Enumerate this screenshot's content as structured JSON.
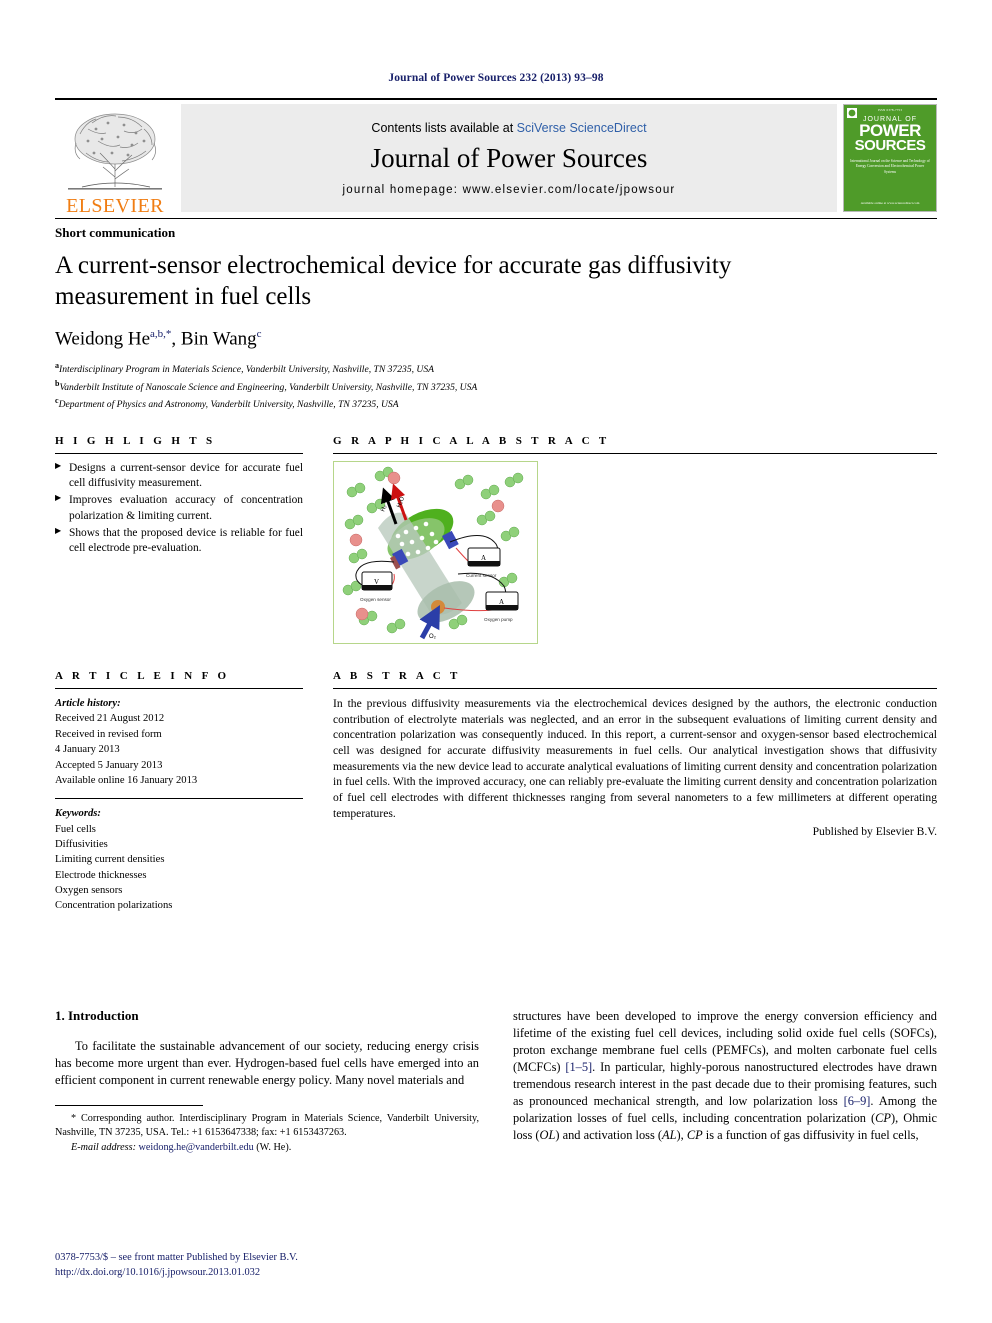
{
  "running_head": "Journal of Power Sources 232 (2013) 93–98",
  "masthead": {
    "publisher_wordmark": "ELSEVIER",
    "contents_prefix": "Contents lists available at ",
    "contents_link": "SciVerse ScienceDirect",
    "journal_title": "Journal of Power Sources",
    "homepage": "journal homepage: www.elsevier.com/locate/jpowsour",
    "cover": {
      "top_label": "ISSN 0378-7753",
      "line1": "JOURNAL OF",
      "line2": "POWER",
      "line3": "SOURCES",
      "subtitle": "International Journal on the Science and Technology of Energy Conversion and Electrochemical Power Systems",
      "footer": "Available online at\nwww.sciencedirect.com"
    }
  },
  "article": {
    "class": "Short communication",
    "title": "A current-sensor electrochemical device for accurate gas diffusivity measurement in fuel cells",
    "authors_html": "Weidong He<sup>a,b,*</sup>, Bin Wang<sup>c</sup>",
    "affiliations": [
      {
        "marker": "a",
        "text": "Interdisciplinary Program in Materials Science, Vanderbilt University, Nashville, TN 37235, USA"
      },
      {
        "marker": "b",
        "text": "Vanderbilt Institute of Nanoscale Science and Engineering, Vanderbilt University, Nashville, TN 37235, USA"
      },
      {
        "marker": "c",
        "text": "Department of Physics and Astronomy, Vanderbilt University, Nashville, TN 37235, USA"
      }
    ]
  },
  "highlights": {
    "heading": "H I G H L I G H T S",
    "items": [
      "Designs a current-sensor device for accurate fuel cell diffusivity measurement.",
      "Improves evaluation accuracy of concentration polarization & limiting current.",
      "Shows that the proposed device is reliable for fuel cell electrode pre-evaluation."
    ]
  },
  "graphical_abstract": {
    "heading": "G R A P H I C A L   A B S T R A C T",
    "labels": {
      "oxygen_sensor": "Oxygen sensor",
      "current_sensor": "Current sensor",
      "oxygen_pump": "Oxygen pump",
      "inlet_gas": "O₂",
      "arrow_in": "H₂",
      "arrow_out": "H₂O",
      "meter_v": "V",
      "meter_a1": "A",
      "meter_a2": "A"
    }
  },
  "article_info": {
    "heading": "A R T I C L E   I N F O",
    "history_label": "Article history:",
    "history": [
      "Received 21 August 2012",
      "Received in revised form",
      "4 January 2013",
      "Accepted 5 January 2013",
      "Available online 16 January 2013"
    ],
    "keywords_label": "Keywords:",
    "keywords": [
      "Fuel cells",
      "Diffusivities",
      "Limiting current densities",
      "Electrode thicknesses",
      "Oxygen sensors",
      "Concentration polarizations"
    ]
  },
  "abstract": {
    "heading": "A B S T R A C T",
    "text": "In the previous diffusivity measurements via the electrochemical devices designed by the authors, the electronic conduction contribution of electrolyte materials was neglected, and an error in the subsequent evaluations of limiting current density and concentration polarization was consequently induced. In this report, a current-sensor and oxygen-sensor based electrochemical cell was designed for accurate diffusivity measurements in fuel cells. Our analytical investigation shows that diffusivity measurements via the new device lead to accurate analytical evaluations of limiting current density and concentration polarization in fuel cells. With the improved accuracy, one can reliably pre-evaluate the limiting current density and concentration polarization of fuel cell electrodes with different thicknesses ranging from several nanometers to a few millimeters at different operating temperatures.",
    "published_by": "Published by Elsevier B.V."
  },
  "body": {
    "section_number_title": "1.  Introduction",
    "left_paragraph": "To facilitate the sustainable advancement of our society, reducing energy crisis has become more urgent than ever. Hydrogen-based fuel cells have emerged into an efficient component in current renewable energy policy. Many novel materials and",
    "right_paragraph_part1": "structures have been developed to improve the energy conversion efficiency and lifetime of the existing fuel cell devices, including solid oxide fuel cells (SOFCs), proton exchange membrane fuel cells (PEMFCs), and molten carbonate fuel cells (MCFCs) ",
    "right_citation1": "[1–5]",
    "right_paragraph_part2": ". In particular, highly-porous nanostructured electrodes have drawn tremendous research interest in the past decade due to their promising features, such as pronounced mechanical strength, and low polarization loss ",
    "right_citation2": "[6–9]",
    "right_paragraph_part3": ". Among the polarization losses of fuel cells, including concentration polarization (",
    "abbr_cp": "CP",
    "right_paragraph_part4": "), Ohmic loss (",
    "abbr_ol": "OL",
    "right_paragraph_part5": ") and activation loss (",
    "abbr_al": "AL",
    "right_paragraph_part6": "), ",
    "abbr_cp2": "CP",
    "right_paragraph_part7": " is a function of gas diffusivity in fuel cells,"
  },
  "footnote": {
    "marker": "*",
    "corresponding": " Corresponding author. Interdisciplinary Program in Materials Science, Vanderbilt University, Nashville, TN 37235, USA. Tel.: +1 6153647338; fax: +1 6153437263.",
    "email_label": "E-mail address:",
    "email": "weidong.he@vanderbilt.edu",
    "email_suffix": " (W. He)."
  },
  "colophon": {
    "issn_line": "0378-7753/$ – see front matter Published by Elsevier B.V.",
    "doi": "http://dx.doi.org/10.1016/j.jpowsour.2013.01.032"
  },
  "colors": {
    "elsevier_orange": "#f07d13",
    "link_blue": "#2f5fa8",
    "navy": "#18206a",
    "cover_green": "#4f9b29",
    "ga_border": "#b6d68a"
  }
}
